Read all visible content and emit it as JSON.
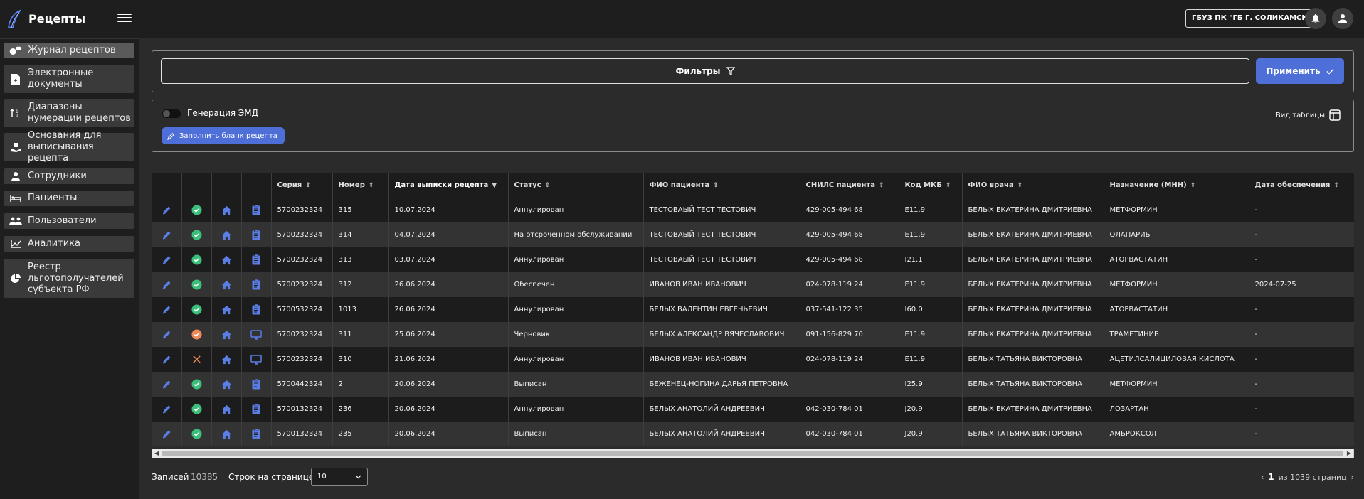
{
  "app": {
    "title": "Рецепты"
  },
  "header": {
    "organization": "ГБУЗ ПК \"ГБ Г. СОЛИКАМСК\""
  },
  "sidebar": {
    "items": [
      {
        "label": "Журнал рецептов",
        "icon": "pills-icon",
        "active": true
      },
      {
        "label": "Электронные документы",
        "icon": "document-icon"
      },
      {
        "label": "Диапазоны нумерации рецептов",
        "icon": "sort-numbers-icon"
      },
      {
        "label": "Основания для выписывания рецепта",
        "icon": "hand-box-icon"
      },
      {
        "label": "Сотрудники",
        "icon": "person-icon"
      },
      {
        "label": "Пациенты",
        "icon": "bed-icon"
      },
      {
        "label": "Пользователи",
        "icon": "group-icon"
      },
      {
        "label": "Аналитика",
        "icon": "chart-line-icon"
      },
      {
        "label": "Реестр льготополучателей субъекта РФ",
        "icon": "pie-chart-icon"
      }
    ]
  },
  "filters": {
    "label": "Фильтры",
    "apply_label": "Применить"
  },
  "actions": {
    "toggle_label": "Генерация ЭМД",
    "fill_label": "Заполнить бланк рецепта",
    "view_label": "Вид таблицы"
  },
  "table": {
    "columns": [
      "Серия",
      "Номер",
      "Дата выписки рецепта",
      "Статус",
      "ФИО пациента",
      "СНИЛС пациента",
      "Код МКБ",
      "ФИО врача",
      "Назначение (МНН)",
      "Дата обеспечения"
    ],
    "rows": [
      {
        "status_icon": "check",
        "type_icon": "clipboard",
        "series": "5700232324",
        "number": "315",
        "date": "10.07.2024",
        "status": "Аннулирован",
        "patient": "ТЕСТОВАЫЙ ТЕСТ ТЕСТОВИЧ",
        "snils": "429-005-494 68",
        "mkb": "E11.9",
        "doctor": "БЕЛЫХ ЕКАТЕРИНА ДМИТРИЕВНА",
        "drug": "МЕТФОРМИН",
        "supply_date": "-"
      },
      {
        "status_icon": "check",
        "type_icon": "clipboard",
        "series": "5700232324",
        "number": "314",
        "date": "04.07.2024",
        "status": "На отсроченном обслуживании",
        "patient": "ТЕСТОВАЫЙ ТЕСТ ТЕСТОВИЧ",
        "snils": "429-005-494 68",
        "mkb": "E11.9",
        "doctor": "БЕЛЫХ ЕКАТЕРИНА ДМИТРИЕВНА",
        "drug": "ОЛАПАРИБ",
        "supply_date": "-"
      },
      {
        "status_icon": "check",
        "type_icon": "clipboard",
        "series": "5700232324",
        "number": "313",
        "date": "03.07.2024",
        "status": "Аннулирован",
        "patient": "ТЕСТОВАЫЙ ТЕСТ ТЕСТОВИЧ",
        "snils": "429-005-494 68",
        "mkb": "I21.1",
        "doctor": "БЕЛЫХ ЕКАТЕРИНА ДМИТРИЕВНА",
        "drug": "АТОРВАСТАТИН",
        "supply_date": "-"
      },
      {
        "status_icon": "check",
        "type_icon": "clipboard",
        "series": "5700232324",
        "number": "312",
        "date": "26.06.2024",
        "status": "Обеспечен",
        "patient": "ИВАНОВ ИВАН ИВАНОВИЧ",
        "snils": "024-078-119 24",
        "mkb": "E11.9",
        "doctor": "БЕЛЫХ ЕКАТЕРИНА ДМИТРИЕВНА",
        "drug": "МЕТФОРМИН",
        "supply_date": "2024-07-25"
      },
      {
        "status_icon": "check",
        "type_icon": "clipboard",
        "series": "5700532324",
        "number": "1013",
        "date": "26.06.2024",
        "status": "Аннулирован",
        "patient": "БЕЛЫХ ВАЛЕНТИН ЕВГЕНЬЕВИЧ",
        "snils": "037-541-122 35",
        "mkb": "I60.0",
        "doctor": "БЕЛЫХ ЕКАТЕРИНА ДМИТРИЕВНА",
        "drug": "АТОРВАСТАТИН",
        "supply_date": "-"
      },
      {
        "status_icon": "warning",
        "type_icon": "monitor",
        "series": "5700232324",
        "number": "311",
        "date": "25.06.2024",
        "status": "Черновик",
        "patient": "БЕЛЫХ АЛЕКСАНДР ВЯЧЕСЛАВОВИЧ",
        "snils": "091-156-829 70",
        "mkb": "E11.9",
        "doctor": "БЕЛЫХ ЕКАТЕРИНА ДМИТРИЕВНА",
        "drug": "ТРАМЕТИНИБ",
        "supply_date": "-"
      },
      {
        "status_icon": "cross",
        "type_icon": "monitor",
        "series": "5700232324",
        "number": "310",
        "date": "21.06.2024",
        "status": "Аннулирован",
        "patient": "ИВАНОВ ИВАН ИВАНОВИЧ",
        "snils": "024-078-119 24",
        "mkb": "E11.9",
        "doctor": "БЕЛЫХ ТАТЬЯНА ВИКТОРОВНА",
        "drug": "АЦЕТИЛСАЛИЦИЛОВАЯ КИСЛОТА",
        "supply_date": "-"
      },
      {
        "status_icon": "check",
        "type_icon": "clipboard",
        "series": "5700442324",
        "number": "2",
        "date": "20.06.2024",
        "status": "Выписан",
        "patient": "БЕЖЕНЕЦ-НОГИНА ДАРЬЯ ПЕТРОВНА",
        "snils": "",
        "mkb": "I25.9",
        "doctor": "БЕЛЫХ ТАТЬЯНА ВИКТОРОВНА",
        "drug": "МЕТФОРМИН",
        "supply_date": "-"
      },
      {
        "status_icon": "check",
        "type_icon": "clipboard",
        "series": "5700132324",
        "number": "236",
        "date": "20.06.2024",
        "status": "Аннулирован",
        "patient": "БЕЛЫХ АНАТОЛИЙ АНДРЕЕВИЧ",
        "snils": "042-030-784 01",
        "mkb": "J20.9",
        "doctor": "БЕЛЫХ ЕКАТЕРИНА ДМИТРИЕВНА",
        "drug": "ЛОЗАРТАН",
        "supply_date": "-"
      },
      {
        "status_icon": "check",
        "type_icon": "clipboard",
        "series": "5700132324",
        "number": "235",
        "date": "20.06.2024",
        "status": "Выписан",
        "patient": "БЕЛЫХ АНАТОЛИЙ АНДРЕЕВИЧ",
        "snils": "042-030-784 01",
        "mkb": "J20.9",
        "doctor": "БЕЛЫХ ТАТЬЯНА ВИКТОРОВНА",
        "drug": "АМБРОКСОЛ",
        "supply_date": "-"
      }
    ]
  },
  "footer": {
    "records_label": "Записей",
    "records_count": "10385",
    "rows_label": "Строк на странице",
    "rows_value": "10",
    "page_current": "1",
    "page_total_text": "из 1039 страниц"
  },
  "colors": {
    "accent": "#4f6fd8",
    "success": "#3bbf7a",
    "warning": "#f08a5a",
    "error": "#f08a5a",
    "edit": "#5b7ee6"
  }
}
